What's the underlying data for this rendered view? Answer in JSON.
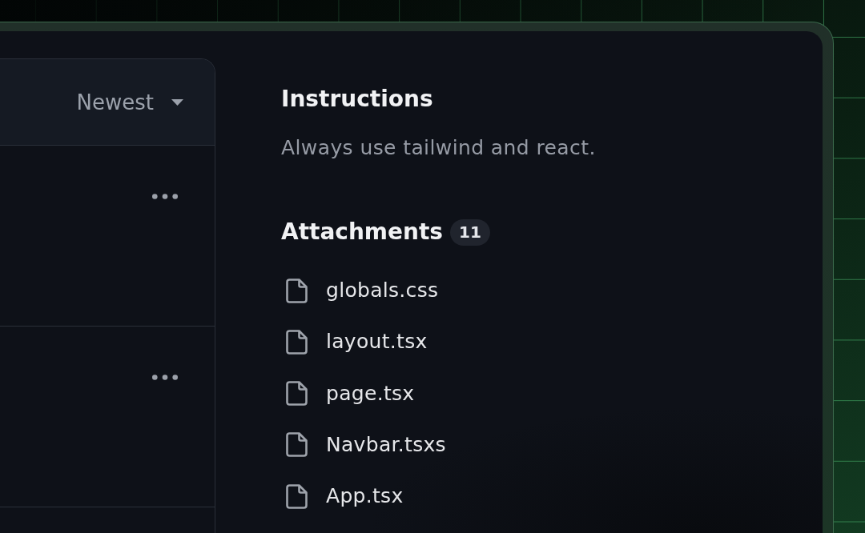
{
  "sort_menu": {
    "label": "Newest"
  },
  "list_rows": [
    {
      "more_button": true
    },
    {
      "more_button": true
    }
  ],
  "instructions": {
    "title": "Instructions",
    "text": "Always use tailwind and react."
  },
  "attachments": {
    "title": "Attachments",
    "count": "11",
    "files": [
      "globals.css",
      "layout.tsx",
      "page.tsx",
      "Navbar.tsxs",
      "App.tsx"
    ]
  }
}
